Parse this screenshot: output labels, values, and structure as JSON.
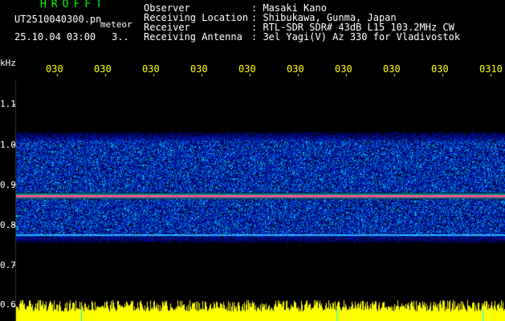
{
  "header": {
    "app_title": "HROFFT",
    "file_name": "UT2510040300.pn",
    "meteor_label": "meteor",
    "date_time": "25.10.04 03:00",
    "count": "3..",
    "info": [
      {
        "label": "Observer",
        "value": ": Masaki Kano"
      },
      {
        "label": "Receiving Location",
        "value": ": Shibukawa, Gunma, Japan"
      },
      {
        "label": "Receiver",
        "value": ": RTL-SDR SDR# 43dB L15 103.2MHz CW"
      },
      {
        "label": "Receiving Antenna",
        "value": ": 3el Yagi(V) Az 330 for Vladivostok"
      }
    ]
  },
  "spectrogram": {
    "y_unit": "kHz",
    "y_ticks": [
      "1.1",
      "1.0",
      "0.9",
      "0.8",
      "0.7",
      "0.6"
    ],
    "x_ticks": [
      "030",
      "030",
      "030",
      "030",
      "030",
      "030",
      "030",
      "030",
      "030",
      "0310"
    ],
    "carrier_khz": 0.873,
    "secondary_line_khz": 0.775,
    "noise_band_khz": [
      0.76,
      1.02
    ],
    "colors": {
      "background": "#000000",
      "noise_low": "#000a78",
      "noise_high": "#14b4ff",
      "carrier": "#ff3c8c",
      "carrier_halo": "#00e68c",
      "baseline_trace": "#ffff00",
      "ticks": "#ffff00",
      "marker": "#00ffff"
    }
  }
}
